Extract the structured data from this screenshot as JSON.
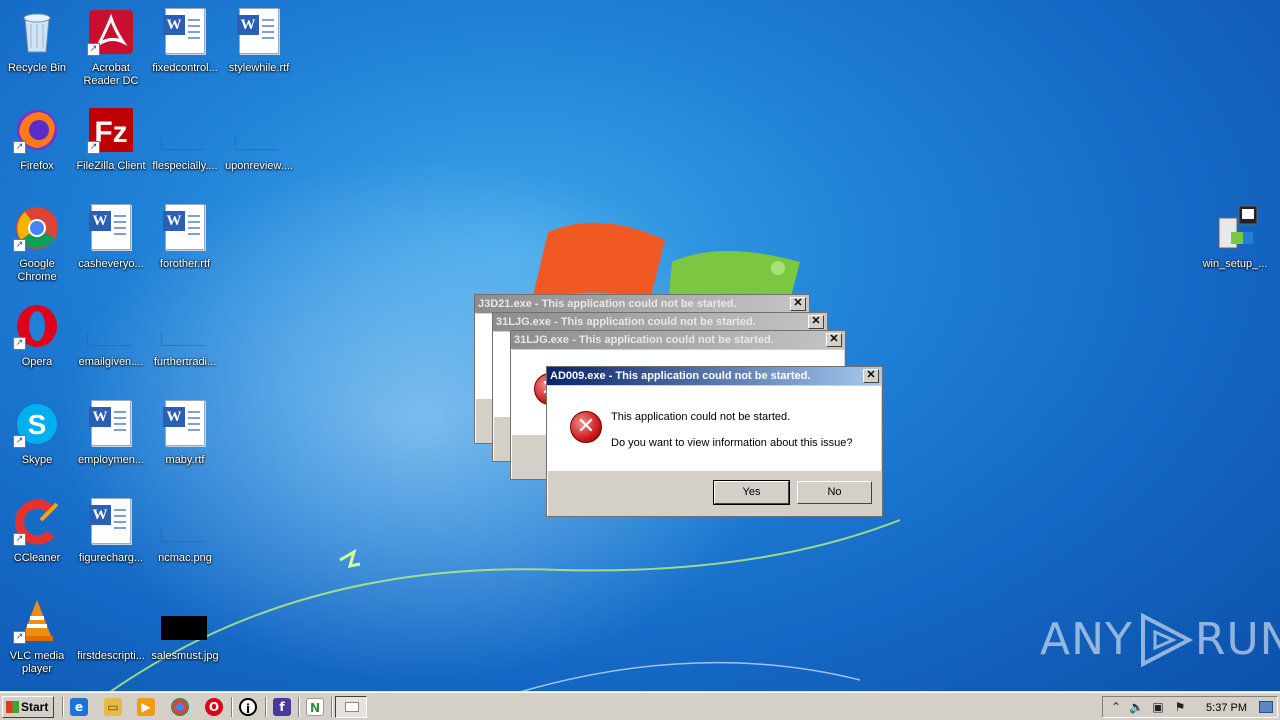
{
  "desktop": {
    "icons": [
      {
        "label": "Recycle Bin",
        "icon": "recycle-bin-icon"
      },
      {
        "label": "Acrobat Reader DC",
        "icon": "acrobat-reader-icon"
      },
      {
        "label": "fixedcontrol...",
        "icon": "word-document-icon"
      },
      {
        "label": "stylewhile.rtf",
        "icon": "word-document-icon"
      },
      {
        "label": "Firefox",
        "icon": "firefox-icon"
      },
      {
        "label": "FileZilla Client",
        "icon": "filezilla-icon"
      },
      {
        "label": "flespecially....",
        "icon": "blank-file-icon"
      },
      {
        "label": "uponreview....",
        "icon": "blank-file-icon"
      },
      {
        "label": "Google Chrome",
        "icon": "chrome-icon"
      },
      {
        "label": "casheveryo...",
        "icon": "word-document-icon"
      },
      {
        "label": "forother.rtf",
        "icon": "word-document-icon"
      },
      {
        "label": "Opera",
        "icon": "opera-icon"
      },
      {
        "label": "emailgiven....",
        "icon": "blank-file-icon"
      },
      {
        "label": "furthertradi...",
        "icon": "blank-file-icon"
      },
      {
        "label": "Skype",
        "icon": "skype-icon"
      },
      {
        "label": "employmen...",
        "icon": "word-document-icon"
      },
      {
        "label": "maby.rtf",
        "icon": "word-document-icon"
      },
      {
        "label": "CCleaner",
        "icon": "ccleaner-icon"
      },
      {
        "label": "figurecharg...",
        "icon": "word-document-icon"
      },
      {
        "label": "ncmac.png",
        "icon": "blank-file-icon"
      },
      {
        "label": "VLC media player",
        "icon": "vlc-icon"
      },
      {
        "label": "firstdescripti...",
        "icon": "blank-file-icon"
      },
      {
        "label": "salesmust.jpg",
        "icon": "image-file-icon"
      },
      {
        "label": "win_setup_...",
        "icon": "installer-icon"
      }
    ]
  },
  "dialogs": {
    "back1": {
      "title": "J3D21.exe - This application could not be started."
    },
    "back2": {
      "title": "31LJG.exe - This application could not be started."
    },
    "back3": {
      "title": "31LJG.exe - This application could not be started."
    },
    "front": {
      "title": "AD009.exe - This application could not be started.",
      "message_line1": "This application could not be started.",
      "message_line2": "Do you want to view information about this issue?",
      "yes_label": "Yes",
      "no_label": "No",
      "close_glyph": "✕"
    }
  },
  "taskbar": {
    "start_label": "Start",
    "clock": "5:37 PM",
    "quick_launch": [
      "internet-explorer-icon",
      "explorer-folder-icon",
      "media-player-icon",
      "chrome-icon",
      "opera-icon",
      "info-icon",
      "app-icon",
      "app-n-icon"
    ]
  },
  "watermark": {
    "left": "ANY",
    "right": "RUN"
  }
}
